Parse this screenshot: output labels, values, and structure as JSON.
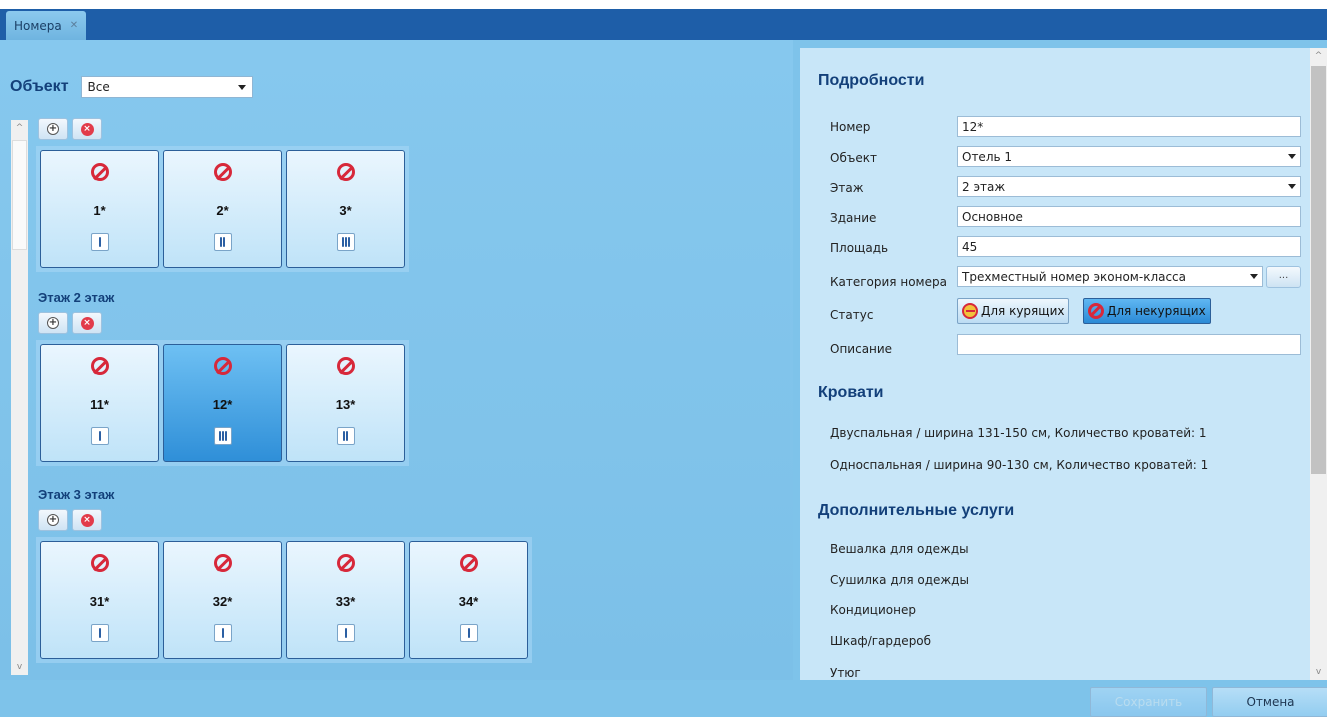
{
  "tab": {
    "label": "Номера",
    "close": "✕"
  },
  "left": {
    "object_label": "Объект",
    "object_value": "Все",
    "floors": [
      {
        "title": "",
        "rooms": [
          {
            "num": "1*",
            "beds": 1
          },
          {
            "num": "2*",
            "beds": 2
          },
          {
            "num": "3*",
            "beds": 3
          }
        ]
      },
      {
        "title": "Этаж 2 этаж",
        "rooms": [
          {
            "num": "11*",
            "beds": 1
          },
          {
            "num": "12*",
            "beds": 3,
            "selected": true
          },
          {
            "num": "13*",
            "beds": 2
          }
        ]
      },
      {
        "title": "Этаж 3 этаж",
        "rooms": [
          {
            "num": "31*",
            "beds": 1
          },
          {
            "num": "32*",
            "beds": 1
          },
          {
            "num": "33*",
            "beds": 1
          },
          {
            "num": "34*",
            "beds": 1
          }
        ]
      }
    ]
  },
  "details": {
    "title": "Подробности",
    "fields": {
      "number": {
        "label": "Номер",
        "value": "12*"
      },
      "object": {
        "label": "Объект",
        "value": "Отель 1"
      },
      "floor": {
        "label": "Этаж",
        "value": "2 этаж"
      },
      "building": {
        "label": "Здание",
        "value": "Основное"
      },
      "area": {
        "label": "Площадь",
        "value": "45"
      },
      "category": {
        "label": "Категория номера",
        "value": "Трехместный номер эконом-класса",
        "more": "..."
      },
      "status": {
        "label": "Статус",
        "smoking": "Для курящих",
        "nonsmoking": "Для некурящих"
      },
      "description": {
        "label": "Описание",
        "value": ""
      }
    }
  },
  "beds": {
    "title": "Кровати",
    "items": [
      "Двуспальная / ширина 131-150 см,  Количество кроватей: 1",
      "Односпальная / ширина 90-130 см,  Количество кроватей: 1"
    ]
  },
  "services": {
    "title": "Дополнительные услуги",
    "items": [
      "Вешалка для одежды",
      "Сушилка для одежды",
      "Кондиционер",
      "Шкаф/гардероб",
      "Утюг"
    ]
  },
  "footer": {
    "save": "Сохранить",
    "cancel": "Отмена"
  },
  "colors": {
    "accent": "#1e5ea8",
    "heading": "#13407a",
    "no_smoking": "#d7283a"
  }
}
